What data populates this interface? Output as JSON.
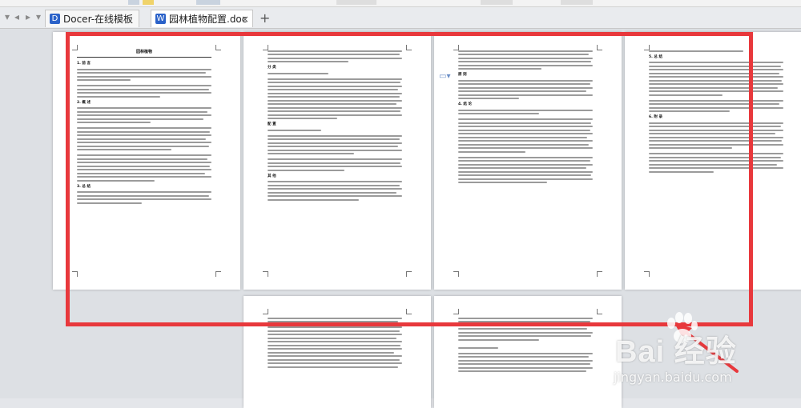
{
  "tabs": [
    {
      "label": "Docer-在线模板",
      "icon": "docer-icon",
      "icon_color": "#2b62c9",
      "active": false
    },
    {
      "label": "园林植物配置.doc *",
      "icon": "wps-writer-icon",
      "icon_color": "#2b62c9",
      "active": true
    }
  ],
  "document": {
    "page1_title": "园林植物",
    "sections": [
      "1. 前 言",
      "2. 概 述",
      "3. 总 结"
    ],
    "page2_sections": [
      "分 类",
      "配 置",
      "其 他"
    ],
    "page3_sections": [
      "原 则",
      "4. 结 论"
    ],
    "page4_sections": [
      "5. 总 结",
      "6. 附 录"
    ]
  },
  "watermark": {
    "main": "Bai 经验",
    "sub": "jingyan.baidu.com"
  },
  "colors": {
    "highlight": "#e8383c",
    "accent": "#2b62c9"
  }
}
